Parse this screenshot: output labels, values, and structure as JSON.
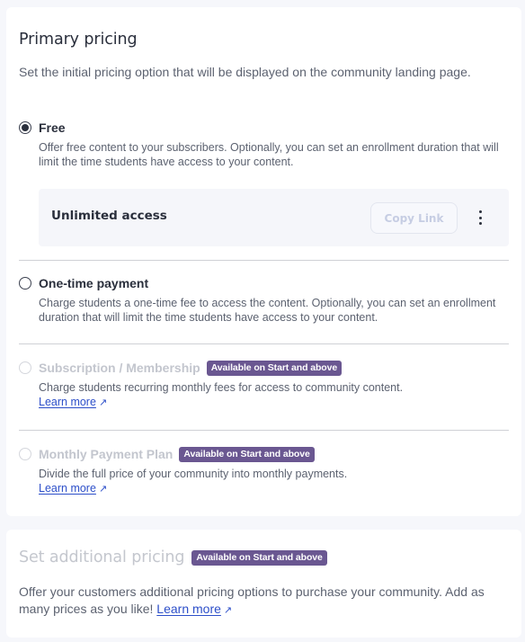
{
  "primary": {
    "title": "Primary pricing",
    "description": "Set the initial pricing option that will be displayed on the community landing page.",
    "options": [
      {
        "id": "free",
        "label": "Free",
        "selected": true,
        "disabled": false,
        "description": "Offer free content to your subscribers. Optionally, you can set an enrollment duration that will limit the time students have access to your content."
      },
      {
        "id": "one-time",
        "label": "One-time payment",
        "selected": false,
        "disabled": false,
        "description": "Charge students a one-time fee to access the content. Optionally, you can set an enrollment duration that will limit the time students have access to your content."
      },
      {
        "id": "subscription",
        "label": "Subscription / Membership",
        "selected": false,
        "disabled": true,
        "badge": "Available on Start and above",
        "description": "Charge students recurring monthly fees for access to community content.",
        "learn_more": "Learn more"
      },
      {
        "id": "monthly-plan",
        "label": "Monthly Payment Plan",
        "selected": false,
        "disabled": true,
        "badge": "Available on Start and above",
        "description": "Divide the full price of your community into monthly payments.",
        "learn_more": "Learn more"
      }
    ],
    "access": {
      "title": "Unlimited access",
      "copy_link_label": "Copy Link",
      "more_icon": "kebab-vertical-icon"
    }
  },
  "additional": {
    "title": "Set additional pricing",
    "badge": "Available on Start and above",
    "description": "Offer your customers additional pricing options to purchase your community. Add as many prices as you like!",
    "learn_more": "Learn more"
  },
  "icons": {
    "external": "↗"
  },
  "colors": {
    "badge_bg": "#6a5791",
    "link": "#2d4fc9",
    "background": "#f6f7fb"
  }
}
